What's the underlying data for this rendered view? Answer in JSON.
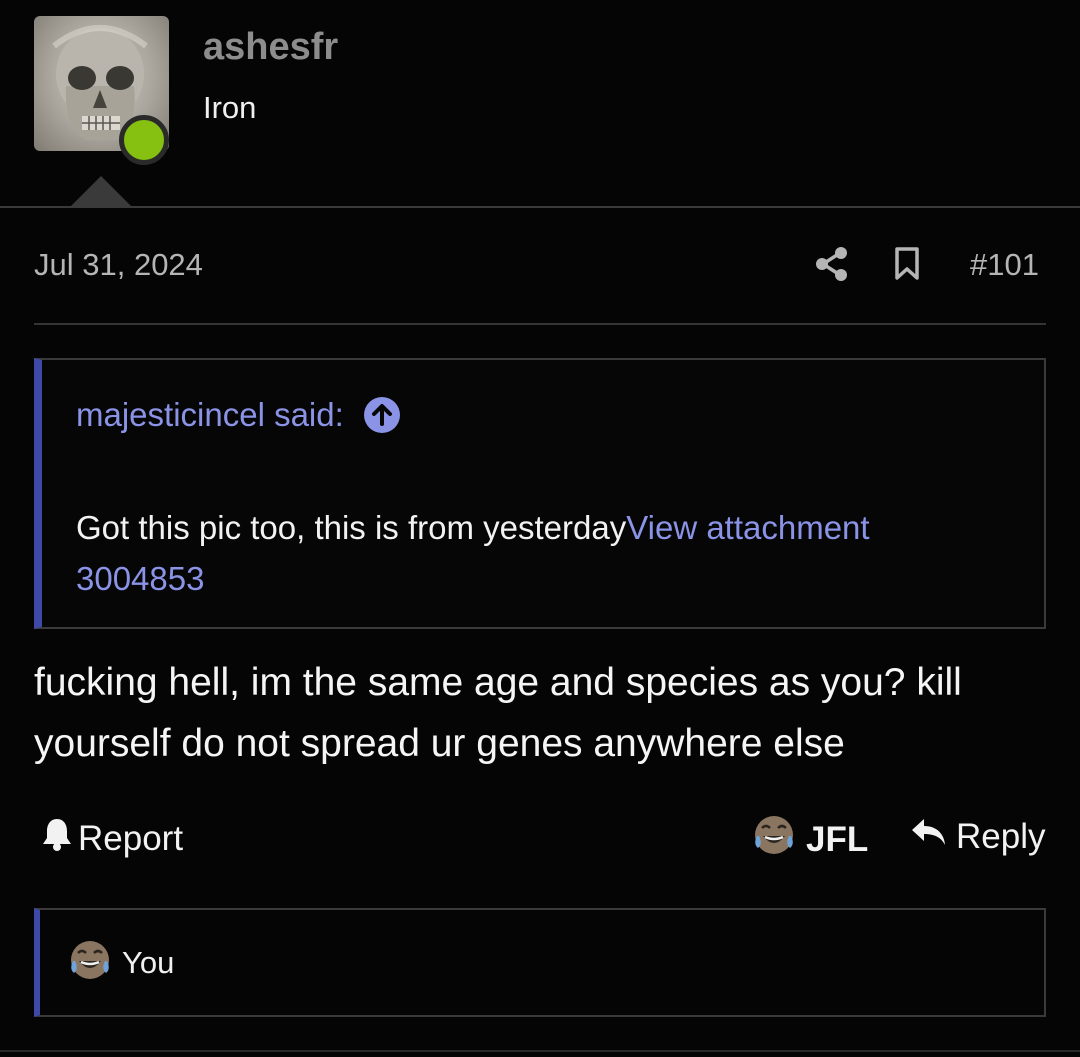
{
  "user": {
    "name": "ashesfr",
    "rank": "Iron",
    "avatar_icon": "skull-avatar",
    "status_color": "#86c010"
  },
  "post": {
    "date": "Jul 31, 2024",
    "number": "#101",
    "icons": [
      "share-icon",
      "bookmark-icon"
    ]
  },
  "quote": {
    "attribution": "majesticincel said:",
    "text": "Got this pic too, this is from yesterday",
    "link_text": "View attachment 3004853",
    "accent_color": "#3f4aa8",
    "link_color": "#8a93e6"
  },
  "message": {
    "text": "fucking hell, im the same age and species as you? kill yourself do not spread ur genes anywhere else"
  },
  "actions": {
    "report_label": "Report",
    "reaction_label": "JFL",
    "reply_label": "Reply"
  },
  "reactions_bar": {
    "label": "You",
    "icon": "laughing-crying-emoji"
  }
}
